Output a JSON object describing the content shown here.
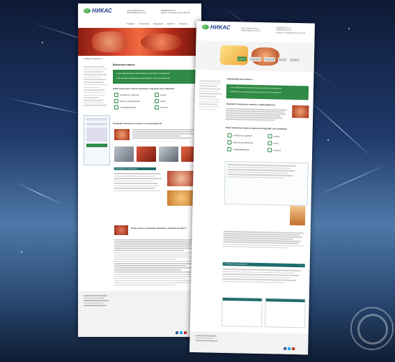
{
  "brand": {
    "name": "НИКАС",
    "color": "#1a3b8a"
  },
  "contact": {
    "line1": "ООО «НИКАС-Плюс»",
    "line2": "oktbaf23@nicas.com.ua",
    "phone": "+38(0562)50-25-17",
    "phone2": "+38(0562)50-33-54",
    "address": "г. Днепр, ул.Будапештская, 45 кв.31"
  },
  "nav": [
    "Главная",
    "О компании",
    "Продукция",
    "Новости",
    "Контакты"
  ],
  "page_title": "Вискозные пакеты",
  "page_title_2": "Термоусадочные пакеты",
  "green_banner": "С нас оформление комплексными услугами по контрактам",
  "green_banner_2": "Собственное производство гарантирует контроль качества",
  "section_h1": "Наши вискозные пакеты идеально подходят для упаковки:",
  "section_h2": "Покупайте вискозные пакеты у производителя",
  "section_h3": "Наши пакеты сохраняют доверие к вашему продукту",
  "tealbar": "Сортаменты и ассортимент",
  "icons": [
    "колбасных изделий",
    "сыров",
    "мясных деликатесов",
    "рыбы",
    "полуфабрикатов",
    "сосисок"
  ],
  "accent": "#2f8b45",
  "teal": "#1e6d6a"
}
